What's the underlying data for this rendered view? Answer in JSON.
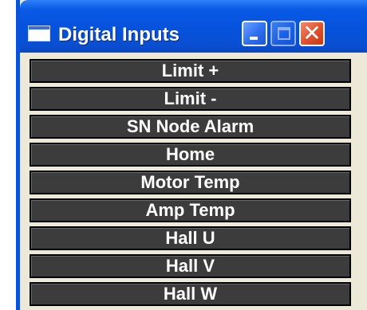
{
  "window": {
    "title": "Digital Inputs",
    "colors": {
      "titlebar": "#0552dc",
      "row_bg": "#3c3c3c",
      "row_text": "#ffffff",
      "close": "#e0502a"
    },
    "buttons": {
      "minimize_icon": "minimize-icon",
      "maximize_icon": "maximize-icon",
      "close_icon": "close-icon"
    }
  },
  "inputs": [
    {
      "label": "Limit +"
    },
    {
      "label": "Limit -"
    },
    {
      "label": "SN Node Alarm"
    },
    {
      "label": "Home"
    },
    {
      "label": "Motor Temp"
    },
    {
      "label": "Amp Temp"
    },
    {
      "label": "Hall U"
    },
    {
      "label": "Hall V"
    },
    {
      "label": "Hall W"
    }
  ]
}
